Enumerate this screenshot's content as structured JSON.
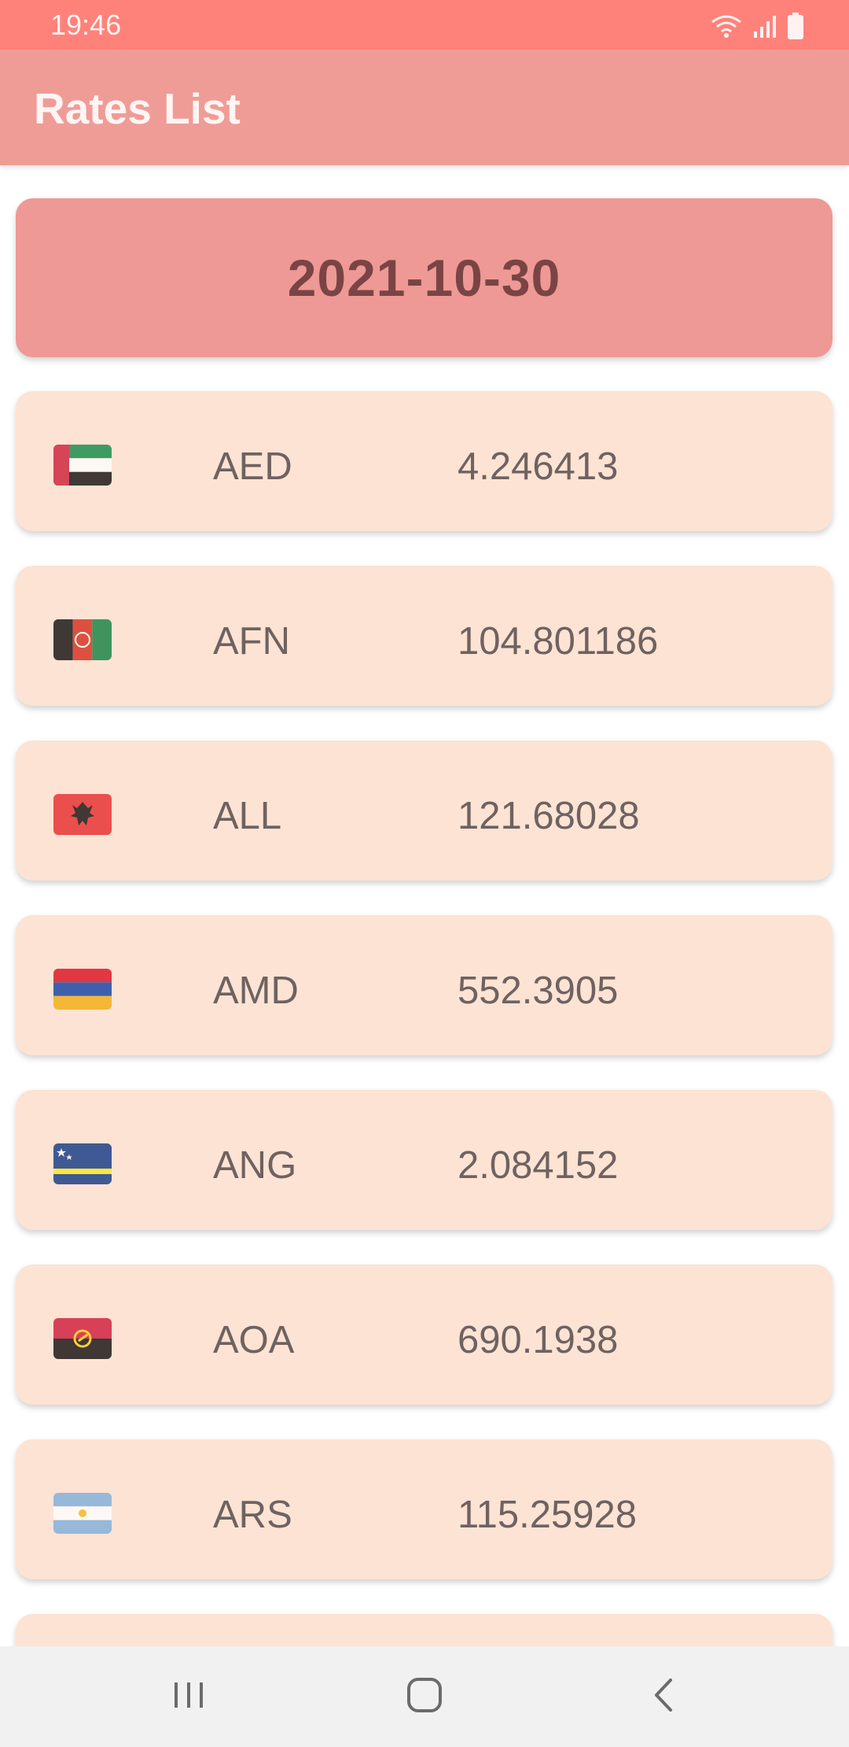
{
  "status_bar": {
    "time": "19:46"
  },
  "app_bar": {
    "title": "Rates List"
  },
  "date_card": {
    "date": "2021-10-30"
  },
  "rates": [
    {
      "code": "AED",
      "value": "4.246413",
      "flag": "flag-uae-icon"
    },
    {
      "code": "AFN",
      "value": "104.801186",
      "flag": "flag-afghanistan-icon"
    },
    {
      "code": "ALL",
      "value": "121.68028",
      "flag": "flag-albania-icon"
    },
    {
      "code": "AMD",
      "value": "552.3905",
      "flag": "flag-armenia-icon"
    },
    {
      "code": "ANG",
      "value": "2.084152",
      "flag": "flag-curacao-icon"
    },
    {
      "code": "AOA",
      "value": "690.1938",
      "flag": "flag-angola-icon"
    },
    {
      "code": "ARS",
      "value": "115.25928",
      "flag": "flag-argentina-icon"
    }
  ],
  "colors": {
    "status_bar": "#ff827a",
    "app_bar": "#ef9c97",
    "date_card": "#ee9995",
    "rate_card": "#fde3d4",
    "text": "#6f6260"
  },
  "nav_bar": {
    "icons": [
      "recent-apps-icon",
      "home-icon",
      "back-icon"
    ]
  }
}
